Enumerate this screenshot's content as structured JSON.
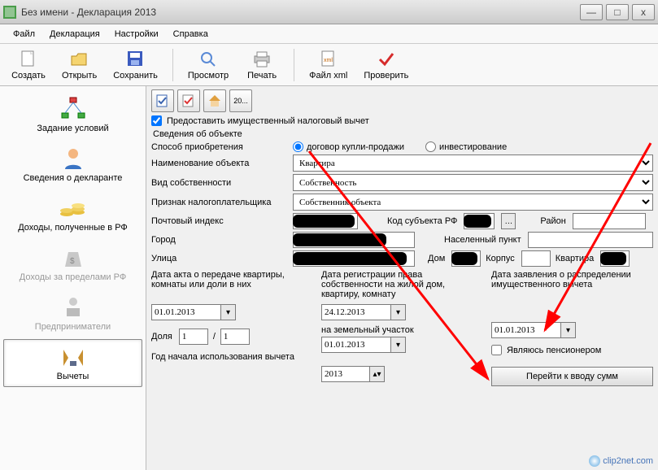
{
  "window": {
    "title": "Без имени - Декларация 2013"
  },
  "menu": {
    "file": "Файл",
    "decl": "Декларация",
    "settings": "Настройки",
    "help": "Справка"
  },
  "toolbar": {
    "create": "Создать",
    "open": "Открыть",
    "save": "Сохранить",
    "preview": "Просмотр",
    "print": "Печать",
    "xml": "Файл xml",
    "check": "Проверить"
  },
  "sidebar": {
    "items": [
      {
        "label": "Задание условий"
      },
      {
        "label": "Сведения о декларанте"
      },
      {
        "label": "Доходы, полученные в РФ"
      },
      {
        "label": "Доходы за пределами РФ"
      },
      {
        "label": "Предприниматели"
      },
      {
        "label": "Вычеты"
      }
    ]
  },
  "mini": {
    "btn4": "20..."
  },
  "form": {
    "provide_checkbox": "Предоставить имущественный налоговый вычет",
    "group": "Сведения об объекте",
    "acq_label": "Способ приобретения",
    "acq_opt1": "договор купли-продажи",
    "acq_opt2": "инвестирование",
    "objname_label": "Наименование объекта",
    "objname_value": "Квартира",
    "owntype_label": "Вид собственности",
    "owntype_value": "Собственность",
    "taxpayer_label": "Признак налогоплательщика",
    "taxpayer_value": "Собственник объекта",
    "postcode_label": "Почтовый индекс",
    "region_label": "Код субъекта РФ",
    "district_label": "Район",
    "city_label": "Город",
    "locality_label": "Населенный пункт",
    "street_label": "Улица",
    "house_label": "Дом",
    "building_label": "Корпус",
    "flat_label": "Квартира",
    "date_act_label": "Дата акта о передаче квартиры, комнаты или доли в них",
    "date_reg_label": "Дата регистрации права собственности на жилой дом, квартиру, комнату",
    "date_appl_label": "Дата заявления о распределении имущественного вычета",
    "date_act_value": "01.01.2013",
    "date_reg_value": "24.12.2013",
    "date_land_label": "на земельный участок",
    "date_land_value": "01.01.2013",
    "date_appl_value": "01.01.2013",
    "share_label": "Доля",
    "share1": "1",
    "share_sep": "/",
    "share2": "1",
    "pensioner": "Являюсь пенсионером",
    "yearstart_label": "Год начала использования вычета",
    "yearstart_value": "2013",
    "go_sums": "Перейти к вводу сумм"
  },
  "watermark": "clip2net.com"
}
